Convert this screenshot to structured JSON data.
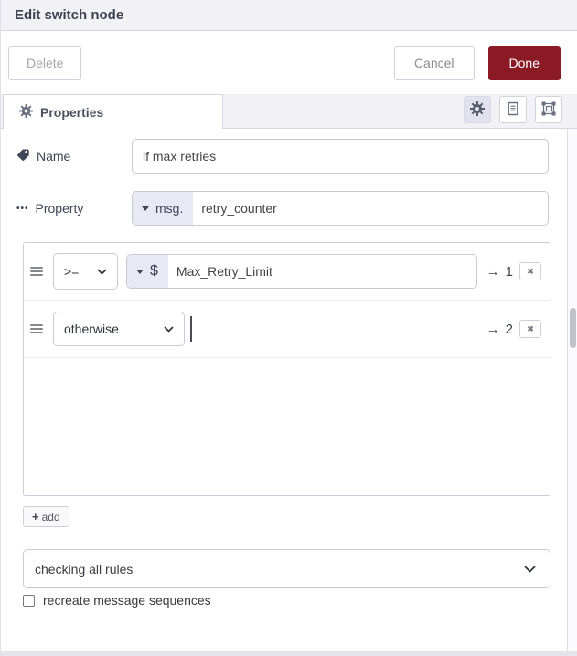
{
  "dialog": {
    "title": "Edit switch node"
  },
  "buttons": {
    "delete": "Delete",
    "cancel": "Cancel",
    "done": "Done"
  },
  "tabs": {
    "properties": "Properties"
  },
  "form": {
    "name_label": "Name",
    "name_value": "if max retries",
    "property_label": "Property",
    "property_prefix": "msg.",
    "property_value": "retry_counter"
  },
  "rules": [
    {
      "operator": ">=",
      "prefix": "$",
      "value": "Max_Retry_Limit",
      "arrow": "→",
      "output": "1"
    },
    {
      "operator": "otherwise",
      "arrow": "→",
      "output": "2"
    }
  ],
  "add_button": {
    "plus": "+",
    "label": "add"
  },
  "mode": {
    "value": "checking all rules"
  },
  "options": {
    "recreate_label": "recreate message sequences",
    "checked": false
  },
  "icons": {
    "close": "✖",
    "ellipsis": "•••"
  },
  "colors": {
    "done_red": "#8c1a25",
    "active_icon_bg": "#e2e2ee",
    "prefix_bg": "#e9e9f5",
    "header_bg": "#f1f1f6"
  }
}
